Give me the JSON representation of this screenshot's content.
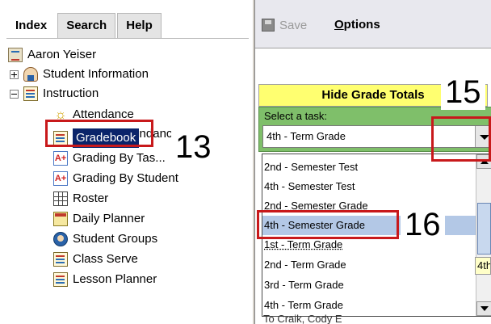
{
  "left_pane": {
    "tabs": [
      {
        "label": "Index",
        "active": true
      },
      {
        "label": "Search",
        "active": false
      },
      {
        "label": "Help",
        "active": false
      }
    ],
    "tree": {
      "root": {
        "label": "Aaron Yeiser",
        "icon": "clipboard-icon"
      },
      "student_information": {
        "label": "Student Information",
        "icon": "person-icon",
        "expander": "+"
      },
      "instruction": {
        "label": "Instruction",
        "icon": "note-icon",
        "expander": "-"
      },
      "items": [
        {
          "label": "Attendance",
          "icon": "sun-icon"
        },
        {
          "label": "Positive Attendance",
          "icon": "sun-icon"
        },
        {
          "label": "Gradebook",
          "icon": "note-icon",
          "selected": true
        },
        {
          "label": "Grading By Tas...",
          "icon": "a-plus-icon"
        },
        {
          "label": "Grading By Student",
          "icon": "a-plus-icon"
        },
        {
          "label": "Roster",
          "icon": "grid-icon"
        },
        {
          "label": "Daily Planner",
          "icon": "planner-icon"
        },
        {
          "label": "Student Groups",
          "icon": "group-icon"
        },
        {
          "label": "Class Serve",
          "icon": "note-icon"
        },
        {
          "label": "Lesson Planner",
          "icon": "note-icon"
        }
      ]
    }
  },
  "right_pane": {
    "toolbar": {
      "save_label": "Save",
      "options_first": "O",
      "options_rest": "ptions"
    },
    "hide_totals_label": "Hide Grade Totals",
    "task_label": "Select a task:",
    "combo_value": "4th - Term Grade",
    "list_items": [
      {
        "label": "2nd - Semester Test"
      },
      {
        "label": "4th - Semester Test"
      },
      {
        "label": "2nd - Semester Grade"
      },
      {
        "label": "4th - Semester Grade",
        "selected": true
      },
      {
        "label": "1st - Term Grade"
      },
      {
        "label": "2nd - Term Grade"
      },
      {
        "label": "3rd - Term Grade"
      },
      {
        "label": "4th - Term Grade"
      }
    ],
    "tooltip_text": "4th",
    "behind_text": "To Craik, Cody E"
  },
  "annotations": {
    "n13": "13",
    "n15": "15",
    "n16": "16"
  },
  "colors": {
    "selection": "#0a246a",
    "highlight_red": "#c8191b",
    "task_panel_green": "#7fbf6a",
    "hide_totals_yellow": "#ffff70",
    "list_selection": "#b3c8e6"
  }
}
